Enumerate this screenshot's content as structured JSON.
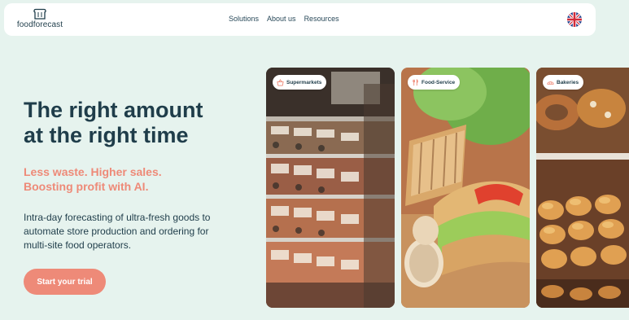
{
  "brand": {
    "name": "foodforecast",
    "logo_icon": "bread-toast-icon"
  },
  "nav": {
    "items": [
      "Solutions",
      "About us",
      "Resources"
    ]
  },
  "language": {
    "flag_icon": "uk-flag-icon"
  },
  "hero": {
    "title_lines": [
      "The right amount",
      "at the right time"
    ],
    "subtitle_lines": [
      "Less waste. Higher sales.",
      "Boosting profit with AI."
    ],
    "description_lines": [
      "Intra-day forecasting of ultra-fresh goods to",
      "automate store production and ordering for",
      "multi-site food operators."
    ],
    "cta_label": "Start your trial"
  },
  "cards": [
    {
      "label": "Supermarkets",
      "icon": "basket-icon"
    },
    {
      "label": "Food-Service",
      "icon": "cutlery-icon"
    },
    {
      "label": "Bakeries",
      "icon": "bread-icon"
    }
  ],
  "colors": {
    "background": "#e6f3ee",
    "navy": "#1f3d4a",
    "accent": "#ee8a78",
    "white": "#ffffff"
  }
}
